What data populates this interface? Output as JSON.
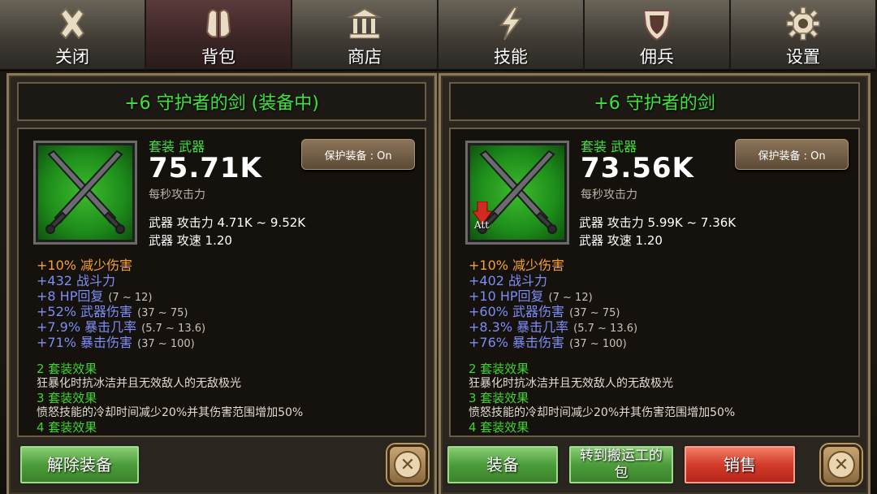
{
  "tabs": [
    {
      "label": "关闭",
      "icon": "close-x-icon"
    },
    {
      "label": "背包",
      "icon": "backpack-icon",
      "active": true
    },
    {
      "label": "商店",
      "icon": "shop-building-icon"
    },
    {
      "label": "技能",
      "icon": "lightning-icon"
    },
    {
      "label": "佣兵",
      "icon": "shield-icon"
    },
    {
      "label": "设置",
      "icon": "gear-icon"
    }
  ],
  "left": {
    "title": "+6 守护者的剑 (装备中)",
    "set_type": "套装 武器",
    "dps": "75.71K",
    "dps_label": "每秒攻击力",
    "protect": "保护装备 : On",
    "weapon_attack": "武器 攻击力 4.71K ~ 9.52K",
    "weapon_speed": "武器 攻速 1.20",
    "affixes": [
      {
        "text": "+10% 减少伤害",
        "range": "",
        "color": "orange"
      },
      {
        "text": "+432 战斗力",
        "range": ""
      },
      {
        "text": "+8 HP回复",
        "range": "(7 ~ 12)"
      },
      {
        "text": "+52% 武器伤害",
        "range": "(37 ~ 75)"
      },
      {
        "text": "+7.9% 暴击几率",
        "range": "(5.7 ~ 13.6)"
      },
      {
        "text": "+71% 暴击伤害",
        "range": "(37 ~ 100)"
      }
    ],
    "set_effects": [
      {
        "head": "2 套装效果",
        "desc": "狂暴化时抗冰洁并且无效敌人的无敌极光"
      },
      {
        "head": "3 套装效果",
        "desc": "愤怒技能的冷却时间减少20%并其伤害范围增加50%"
      },
      {
        "head": "4 套装效果",
        "desc": ""
      }
    ],
    "btn_unequip": "解除装备"
  },
  "right": {
    "title": "+6 守护者的剑",
    "set_type": "套装 武器",
    "dps": "73.56K",
    "dps_label": "每秒攻击力",
    "protect": "保护装备 : On",
    "att_label": "Att",
    "weapon_attack": "武器 攻击力 5.99K ~ 7.36K",
    "weapon_speed": "武器 攻速 1.20",
    "affixes": [
      {
        "text": "+10% 减少伤害",
        "range": "",
        "color": "orange"
      },
      {
        "text": "+402 战斗力",
        "range": ""
      },
      {
        "text": "+10 HP回复",
        "range": "(7 ~ 12)"
      },
      {
        "text": "+60% 武器伤害",
        "range": "(37 ~ 75)"
      },
      {
        "text": "+8.3% 暴击几率",
        "range": "(5.7 ~ 13.6)"
      },
      {
        "text": "+76% 暴击伤害",
        "range": "(37 ~ 100)"
      }
    ],
    "set_effects": [
      {
        "head": "2 套装效果",
        "desc": "狂暴化时抗冰洁并且无效敌人的无敌极光"
      },
      {
        "head": "3 套装效果",
        "desc": "愤怒技能的冷却时间减少20%并其伤害范围增加50%"
      },
      {
        "head": "4 套装效果",
        "desc": ""
      }
    ],
    "btn_equip": "装备",
    "btn_transfer": "转到搬运工的包",
    "btn_sell": "销售"
  },
  "colors": {
    "green_text": "#3fe13c",
    "blue_text": "#7d8df5",
    "orange_text": "#f7a135"
  }
}
